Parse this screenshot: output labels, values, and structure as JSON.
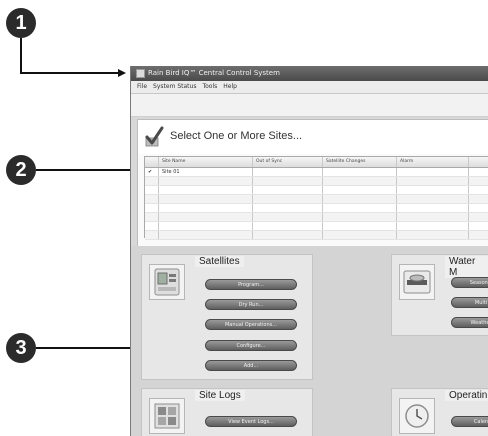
{
  "callouts": [
    "1",
    "2",
    "3"
  ],
  "window": {
    "title": "Rain Bird IQ™ Central Control System",
    "menu": [
      "File",
      "System Status",
      "Tools",
      "Help"
    ]
  },
  "sites": {
    "heading": "Select One or More Sites...",
    "columns": [
      "",
      "Site Name",
      "Out of Sync",
      "Satellite Changes",
      "Alarm",
      ""
    ],
    "rows": [
      {
        "check": "✔",
        "name": "Site 01"
      }
    ]
  },
  "satellites": {
    "label": "Satellites",
    "buttons": [
      "Program...",
      "Dry Run...",
      "Manual Operations...",
      "Configure...",
      "Add..."
    ]
  },
  "water": {
    "label": "Water M",
    "buttons": [
      "Seasonal",
      "Multi",
      "Weather"
    ]
  },
  "site_logs": {
    "label": "Site Logs",
    "buttons": [
      "View Event Logs..."
    ]
  },
  "operations": {
    "label": "Operatin",
    "buttons": [
      "Calen"
    ]
  }
}
